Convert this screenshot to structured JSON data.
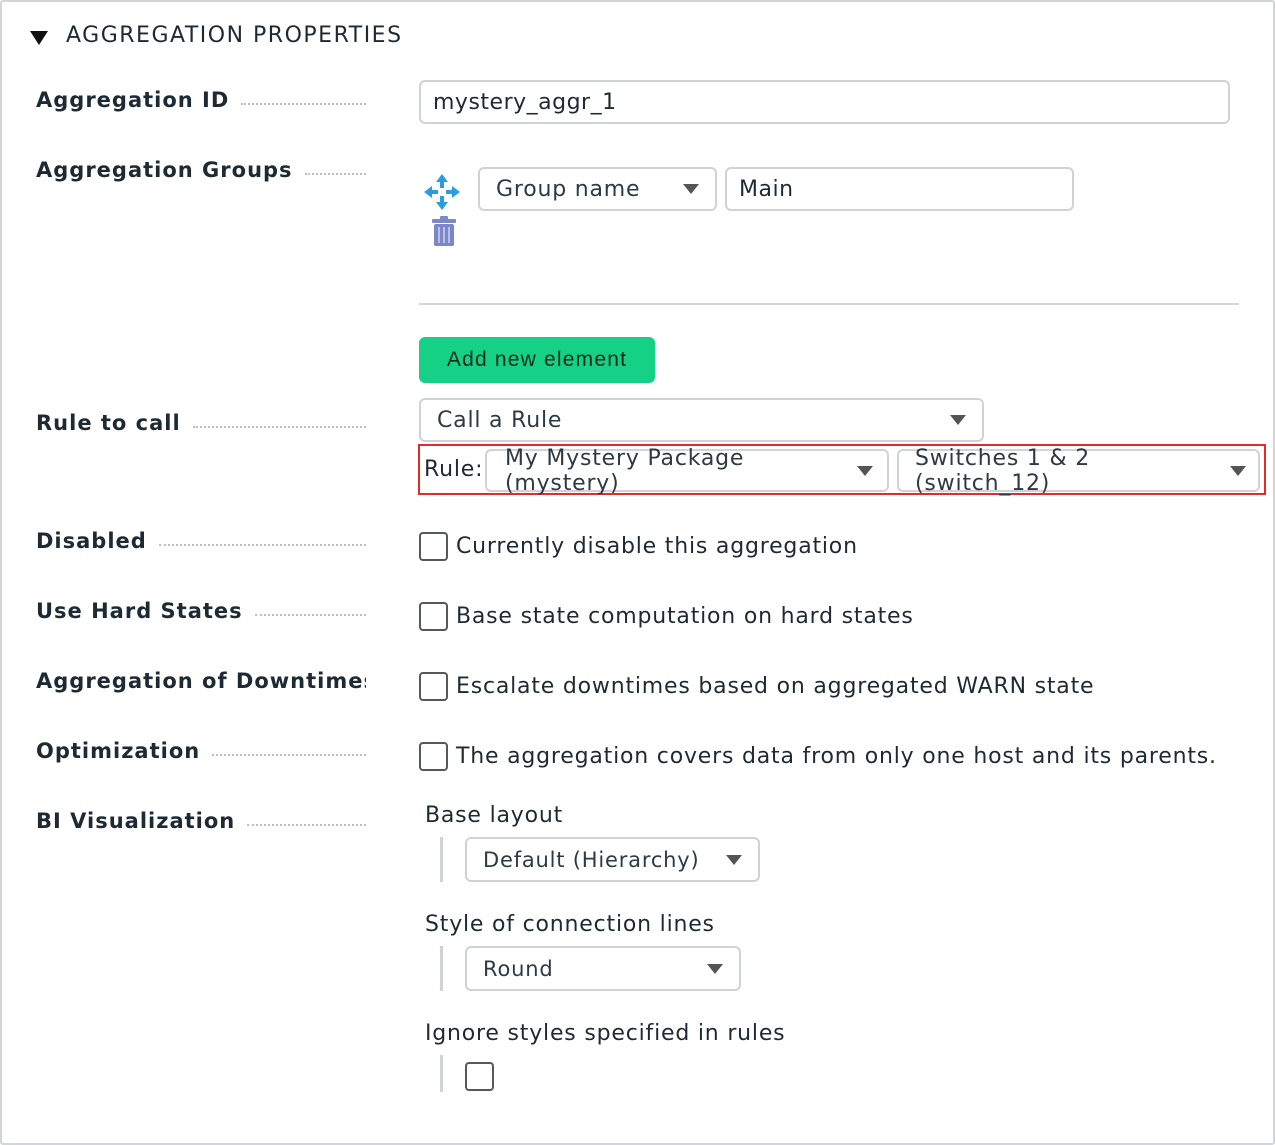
{
  "section": {
    "title": "AGGREGATION PROPERTIES"
  },
  "fields": {
    "aggregation_id": {
      "label": "Aggregation ID",
      "value": "mystery_aggr_1"
    },
    "aggregation_groups": {
      "label": "Aggregation Groups",
      "group_select": "Group name",
      "group_value": "Main",
      "add_button": "Add new element"
    },
    "rule_to_call": {
      "label": "Rule to call",
      "select": "Call a Rule",
      "rule_label": "Rule:",
      "package_select": "My Mystery Package (mystery)",
      "rule_select": "Switches 1 & 2 (switch_12)"
    },
    "disabled": {
      "label": "Disabled",
      "checkbox_text": "Currently disable this aggregation"
    },
    "hard_states": {
      "label": "Use Hard States",
      "checkbox_text": "Base state computation on hard states"
    },
    "downtimes": {
      "label": "Aggregation of Downtimes",
      "checkbox_text": "Escalate downtimes based on aggregated WARN state"
    },
    "optimization": {
      "label": "Optimization",
      "checkbox_text": "The aggregation covers data from only one host and its parents."
    },
    "bi_visualization": {
      "label": "BI Visualization",
      "base_layout_label": "Base layout",
      "base_layout_value": "Default (Hierarchy)",
      "connection_lines_label": "Style of connection lines",
      "connection_lines_value": "Round",
      "ignore_styles_label": "Ignore styles specified in rules"
    }
  },
  "colors": {
    "accent_green": "#15d185",
    "highlight_red": "#e32b2b",
    "icon_blue": "#2a9de0",
    "trash_icon": "#7c86c9"
  },
  "icons": {
    "move": "move-arrows-icon",
    "delete": "trash-icon",
    "collapse": "triangle-down-icon"
  }
}
